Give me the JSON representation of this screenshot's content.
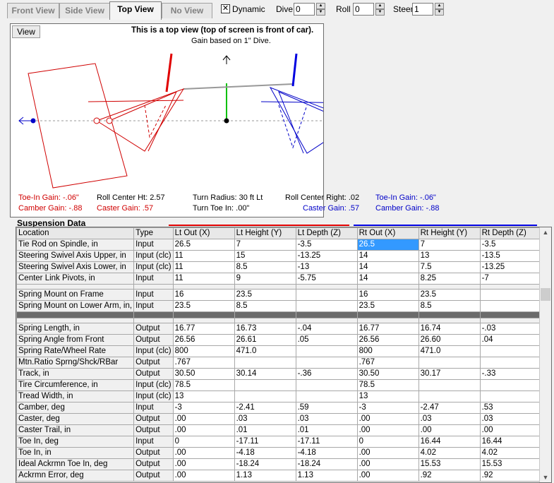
{
  "tabs": [
    {
      "label": "Front View",
      "active": false
    },
    {
      "label": "Side View",
      "active": false
    },
    {
      "label": "Top View",
      "active": true
    },
    {
      "label": "No View",
      "active": false
    }
  ],
  "controls": {
    "dynamic_label": "Dynamic",
    "dynamic_checked": "✕",
    "dive_label": "Dive",
    "dive_value": "0",
    "roll_label": "Roll",
    "roll_value": "0",
    "steer_label": "Steer",
    "steer_value": "1"
  },
  "view_panel": {
    "view_button": "View",
    "title": "This is a top view (top of screen is front of car).",
    "subtitle": "Gain based on 1\" Dive.",
    "toe_in_gain_left": "Toe-In Gain: -.06\"",
    "camber_gain_left": "Camber Gain: -.88",
    "roll_center_ht": "Roll Center Ht: 2.57",
    "caster_gain_left": "Caster Gain: .57",
    "turn_radius": "Turn Radius: 30 ft Lt",
    "turn_toe_in": "Turn Toe In: .00\"",
    "roll_center_right": "Roll Center Right: .02",
    "caster_gain_right": "Caster Gain: .57",
    "toe_in_gain_right": "Toe-In Gain: -.06\"",
    "camber_gain_right": "Camber Gain: -.88"
  },
  "section_title": "Suspension Data",
  "accent_colors": {
    "left": "#e00000",
    "right": "#0000e0"
  },
  "table": {
    "headers": [
      "Location",
      "Type",
      "Lt Out (X)",
      "Lt Height (Y)",
      "Lt Depth (Z)",
      "Rt Out (X)",
      "Rt Height (Y)",
      "Rt Depth (Z)"
    ],
    "rows": [
      [
        "Tie Rod on Spindle, in",
        "Input",
        "26.5",
        "7",
        "-3.5",
        "26.5",
        "7",
        "-3.5"
      ],
      [
        "Steering Swivel Axis Upper, in",
        "Input (clc)",
        "11",
        "15",
        "-13.25",
        "14",
        "13",
        "-13.5"
      ],
      [
        "Steering Swivel Axis Lower, in",
        "Input (clc)",
        "11",
        "8.5",
        "-13",
        "14",
        "7.5",
        "-13.25"
      ],
      [
        "Center Link Pivots, in",
        "Input",
        "11",
        "9",
        "-5.75",
        "14",
        "8.25",
        "-7"
      ],
      [
        "Spring Mount on Frame",
        "Input",
        "16",
        "23.5",
        "",
        "16",
        "23.5",
        ""
      ],
      [
        "Spring Mount on Lower Arm, in,",
        "Input",
        "23.5",
        "8.5",
        "",
        "23.5",
        "8.5",
        ""
      ],
      [
        "Spring Length, in",
        "Output",
        "16.77",
        "16.73",
        "-.04",
        "16.77",
        "16.74",
        "-.03"
      ],
      [
        "Spring Angle from Front",
        "Output",
        "26.56",
        "26.61",
        ".05",
        "26.56",
        "26.60",
        ".04"
      ],
      [
        "Spring Rate/Wheel Rate",
        "Input (clc)",
        "800",
        "471.0",
        "",
        "800",
        "471.0",
        ""
      ],
      [
        "Mtn.Ratio Sprng/Shck/RBar",
        "Output",
        ".767",
        "",
        "",
        ".767",
        "",
        ""
      ],
      [
        "Track, in",
        "Output",
        "30.50",
        "30.14",
        "-.36",
        "30.50",
        "30.17",
        "-.33"
      ],
      [
        "Tire Circumference, in",
        "Input (clc)",
        "78.5",
        "",
        "",
        "78.5",
        "",
        ""
      ],
      [
        "Tread Width, in",
        "Input (clc)",
        "13",
        "",
        "",
        "13",
        "",
        ""
      ],
      [
        "Camber, deg",
        "Input",
        "-3",
        "-2.41",
        ".59",
        "-3",
        "-2.47",
        ".53"
      ],
      [
        "Caster, deg",
        "Output",
        ".00",
        ".03",
        ".03",
        ".00",
        ".03",
        ".03"
      ],
      [
        "Caster Trail, in",
        "Output",
        ".00",
        ".01",
        ".01",
        ".00",
        ".00",
        ".00"
      ],
      [
        "Toe In, deg",
        "Input",
        "0",
        "-17.11",
        "-17.11",
        "0",
        "16.44",
        "16.44"
      ],
      [
        "Toe In, in",
        "Output",
        ".00",
        "-4.18",
        "-4.18",
        ".00",
        "4.02",
        "4.02"
      ],
      [
        "Ideal Ackrmn Toe In, deg",
        "Output",
        ".00",
        "-18.24",
        "-18.24",
        ".00",
        "15.53",
        "15.53"
      ],
      [
        "Ackrmn Error, deg",
        "Output",
        ".00",
        "1.13",
        "1.13",
        ".00",
        ".92",
        ".92"
      ]
    ]
  }
}
